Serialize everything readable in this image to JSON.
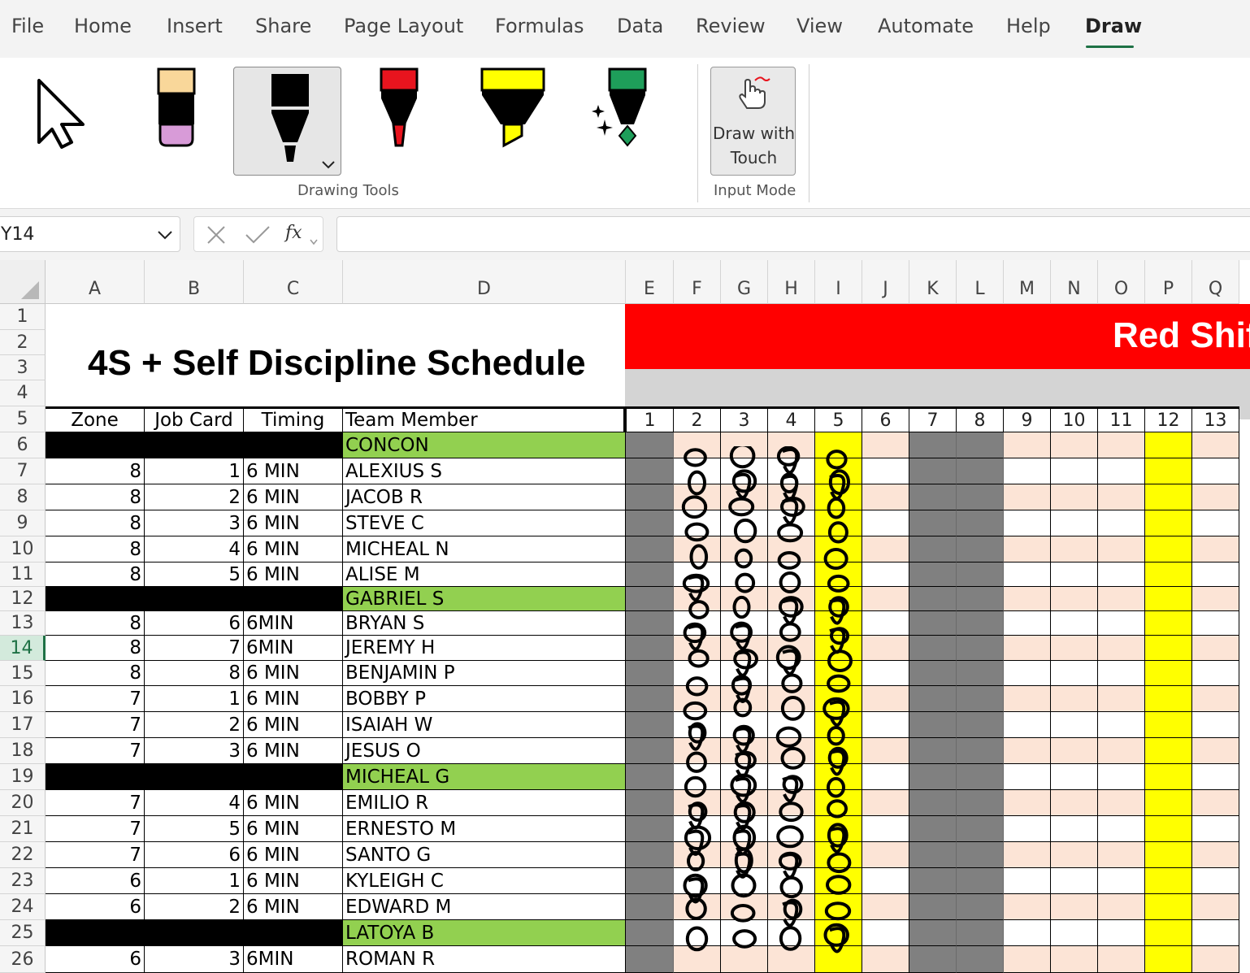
{
  "menu": {
    "items": [
      "File",
      "Home",
      "Insert",
      "Share",
      "Page Layout",
      "Formulas",
      "Data",
      "Review",
      "View",
      "Automate",
      "Help",
      "Draw"
    ],
    "active": "Draw"
  },
  "ribbon": {
    "tools": [
      {
        "name": "select-pointer-icon",
        "label": ""
      },
      {
        "name": "eraser-icon",
        "label": ""
      },
      {
        "name": "black-pen-icon",
        "label": ""
      },
      {
        "name": "red-pen-icon",
        "label": ""
      },
      {
        "name": "yellow-highlighter-icon",
        "label": ""
      },
      {
        "name": "green-galaxy-pen-icon",
        "label": ""
      }
    ],
    "drawing_tools_label": "Drawing Tools",
    "draw_with_touch_line1": "Draw with",
    "draw_with_touch_line2": "Touch",
    "input_mode_label": "Input Mode"
  },
  "formula_bar": {
    "name_box": "Y14",
    "fx_label": "fx",
    "formula": ""
  },
  "sheet": {
    "columns": [
      "A",
      "B",
      "C",
      "D",
      "E",
      "F",
      "G",
      "H",
      "I",
      "J",
      "K",
      "L",
      "M",
      "N",
      "O",
      "P",
      "Q"
    ],
    "rows": [
      "1",
      "2",
      "3",
      "4",
      "5",
      "6",
      "7",
      "8",
      "9",
      "10",
      "11",
      "12",
      "13",
      "14",
      "15",
      "16",
      "17",
      "18",
      "19",
      "20",
      "21",
      "22",
      "23",
      "24",
      "25",
      "26"
    ],
    "active_row": "14",
    "title": "4S + Self Discipline Schedule",
    "banner": "Red Shift",
    "headers": [
      "Zone",
      "Job Card",
      "Timing",
      "Team Member"
    ],
    "day_numbers": [
      "1",
      "2",
      "3",
      "4",
      "5",
      "6",
      "7",
      "8",
      "9",
      "10",
      "11",
      "12",
      "13"
    ],
    "data_rows": [
      {
        "type": "group",
        "member": "CONCON"
      },
      {
        "zone": "8",
        "card": "1",
        "timing": "6 MIN",
        "member": "ALEXIUS S"
      },
      {
        "zone": "8",
        "card": "2",
        "timing": "6 MIN",
        "member": "JACOB R"
      },
      {
        "zone": "8",
        "card": "3",
        "timing": "6 MIN",
        "member": "STEVE C"
      },
      {
        "zone": "8",
        "card": "4",
        "timing": "6 MIN",
        "member": "MICHEAL N"
      },
      {
        "zone": "8",
        "card": "5",
        "timing": "6 MIN",
        "member": "ALISE M"
      },
      {
        "type": "group",
        "member": "GABRIEL S"
      },
      {
        "zone": "8",
        "card": "6",
        "timing": "6MIN",
        "member": "BRYAN S"
      },
      {
        "zone": "8",
        "card": "7",
        "timing": "6MIN",
        "member": "JEREMY H"
      },
      {
        "zone": "8",
        "card": "8",
        "timing": "6 MIN",
        "member": "BENJAMIN P"
      },
      {
        "zone": "7",
        "card": "1",
        "timing": "6 MIN",
        "member": "BOBBY P"
      },
      {
        "zone": "7",
        "card": "2",
        "timing": "6 MIN",
        "member": "ISAIAH W"
      },
      {
        "zone": "7",
        "card": "3",
        "timing": "6 MIN",
        "member": "JESUS O"
      },
      {
        "type": "group",
        "member": "MICHEAL G"
      },
      {
        "zone": "7",
        "card": "4",
        "timing": "6 MIN",
        "member": "EMILIO R"
      },
      {
        "zone": "7",
        "card": "5",
        "timing": "6 MIN",
        "member": "ERNESTO M"
      },
      {
        "zone": "7",
        "card": "6",
        "timing": "6 MIN",
        "member": "SANTO G"
      },
      {
        "zone": "6",
        "card": "1",
        "timing": "6 MIN",
        "member": "KYLEIGH C"
      },
      {
        "zone": "6",
        "card": "2",
        "timing": " 6 MIN",
        "member": "EDWARD M"
      },
      {
        "type": "group",
        "member": "LATOYA B"
      },
      {
        "zone": "6",
        "card": "3",
        "timing": "6MIN",
        "member": "ROMAN R"
      }
    ],
    "colors": {
      "banner_red": "#ff0000",
      "group_green": "#92d050",
      "weekend_grey": "#808080",
      "highlight_yellow": "#ffff00",
      "shade_peach": "#fce4d6",
      "accent_green": "#1e7145"
    },
    "day_column_types": [
      "grey",
      "peach",
      "peach",
      "peach",
      "yellow",
      "peach",
      "grey",
      "grey",
      "peach",
      "peach",
      "peach",
      "yellow",
      "peach"
    ]
  }
}
